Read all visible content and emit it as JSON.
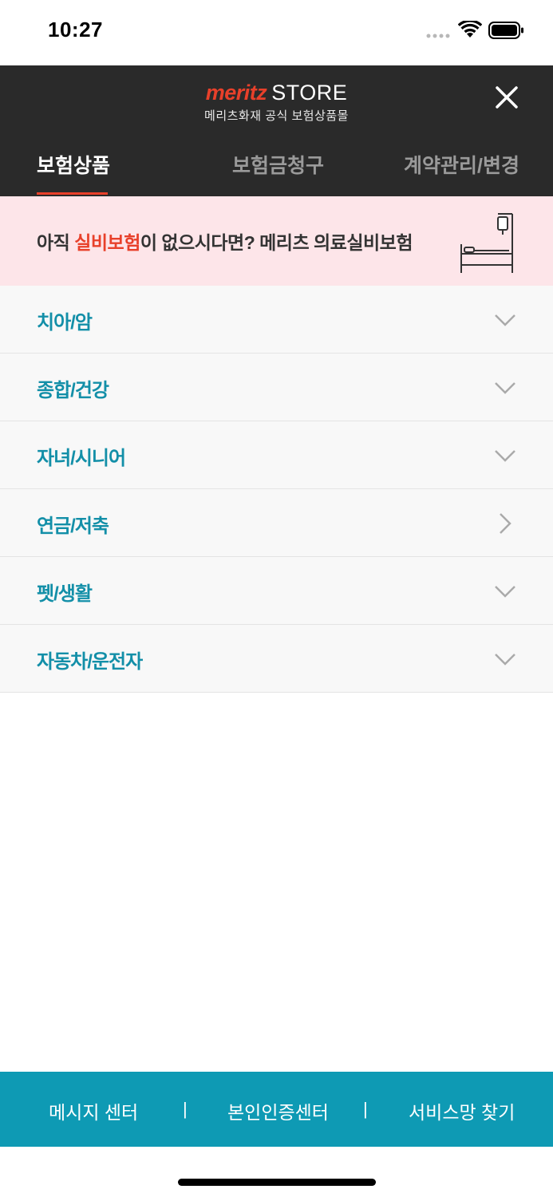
{
  "status_bar": {
    "time": "10:27"
  },
  "header": {
    "brand_name": "meritz",
    "brand_store": "STORE",
    "brand_subtitle": "메리츠화재 공식 보험상품몰",
    "close_icon": "close-icon",
    "tabs": [
      {
        "label": "보험상품",
        "active": true
      },
      {
        "label": "보험금청구",
        "active": false
      },
      {
        "label": "계약관리/변경",
        "active": false
      }
    ]
  },
  "promo": {
    "text_before": "아직 ",
    "text_highlight": "실비보험",
    "text_after": "이 없으시다면? 메리츠 의료실비보험",
    "icon": "hospital-bed-icon"
  },
  "menu": {
    "items": [
      {
        "label": "치아/암",
        "icon": "chevron-down-icon"
      },
      {
        "label": "종합/건강",
        "icon": "chevron-down-icon"
      },
      {
        "label": "자녀/시니어",
        "icon": "chevron-down-icon"
      },
      {
        "label": "연금/저축",
        "icon": "chevron-right-icon"
      },
      {
        "label": "펫/생활",
        "icon": "chevron-down-icon"
      },
      {
        "label": "자동차/운전자",
        "icon": "chevron-down-icon"
      }
    ]
  },
  "footer": {
    "links": [
      "메시지 센터",
      "본인인증센터",
      "서비스망 찾기"
    ],
    "separator": "|"
  },
  "colors": {
    "header_bg": "#2a2a2a",
    "brand_accent": "#e8402a",
    "promo_bg": "#fde5e9",
    "menu_text": "#138fa8",
    "footer_bg": "#0e9ab4"
  }
}
